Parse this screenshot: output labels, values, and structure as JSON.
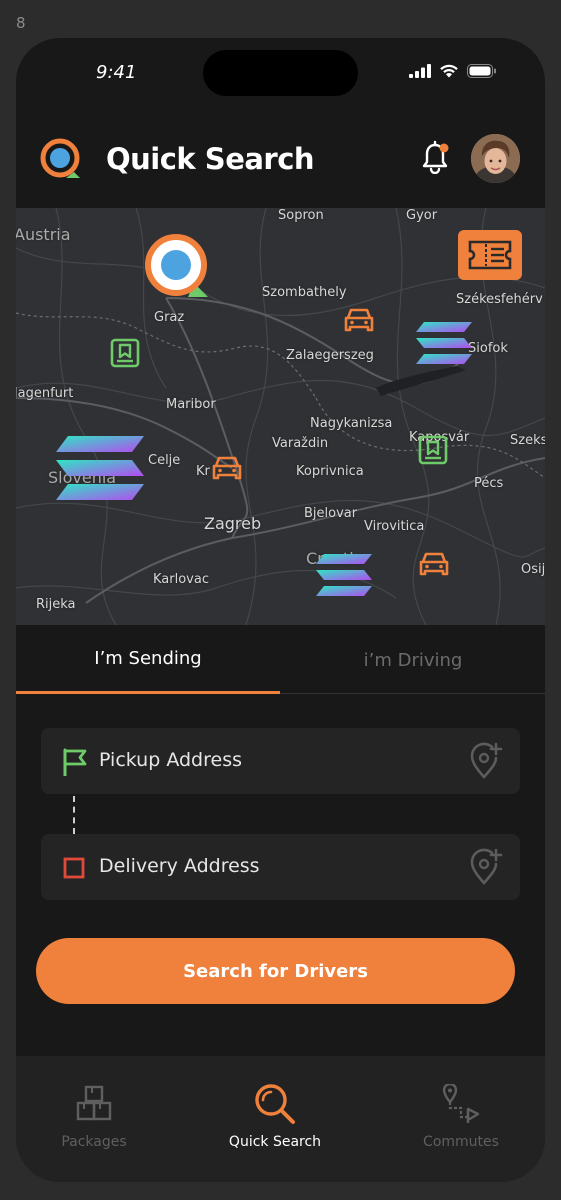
{
  "frame_label": "8",
  "status_bar": {
    "time": "9:41"
  },
  "header": {
    "title": "Quick Search"
  },
  "colors": {
    "accent": "#f0813d",
    "green": "#6fcb6a",
    "red": "#e04a3b",
    "background": "#181818"
  },
  "map": {
    "labels": [
      {
        "text": "Austria",
        "style": "big"
      },
      {
        "text": "Sopron"
      },
      {
        "text": "Gyor"
      },
      {
        "text": "Szombathely"
      },
      {
        "text": "Székesfehérv"
      },
      {
        "text": "Graz"
      },
      {
        "text": "Zalaegerszeg"
      },
      {
        "text": "Siofok"
      },
      {
        "text": "lagenfurt"
      },
      {
        "text": "Maribor"
      },
      {
        "text": "Nagykanizsa"
      },
      {
        "text": "Celje"
      },
      {
        "text": "Varaždin"
      },
      {
        "text": "Koprivnica"
      },
      {
        "text": "Kaposvár"
      },
      {
        "text": "Szeks"
      },
      {
        "text": "Slovenia",
        "style": "big"
      },
      {
        "text": "Kr"
      },
      {
        "text": "Pécs"
      },
      {
        "text": "Zagreb",
        "style": "big"
      },
      {
        "text": "Bjelovar"
      },
      {
        "text": "Virovitica"
      },
      {
        "text": "Croatia",
        "style": "big"
      },
      {
        "text": "Karlovac"
      },
      {
        "text": "Osij"
      },
      {
        "text": "Rijeka"
      }
    ],
    "markers": [
      "location-pin-marker",
      "ticket-marker",
      "car-marker",
      "car-marker",
      "car-marker",
      "package-marker",
      "package-marker",
      "token-marker",
      "token-marker",
      "token-marker"
    ]
  },
  "tabs": {
    "sending": "I’m Sending",
    "driving": "i’m Driving"
  },
  "form": {
    "pickup_label": "Pickup Address",
    "delivery_label": "Delivery Address",
    "search_label": "Search for Drivers"
  },
  "nav": {
    "packages": "Packages",
    "quick_search": "Quick Search",
    "commutes": "Commutes"
  }
}
